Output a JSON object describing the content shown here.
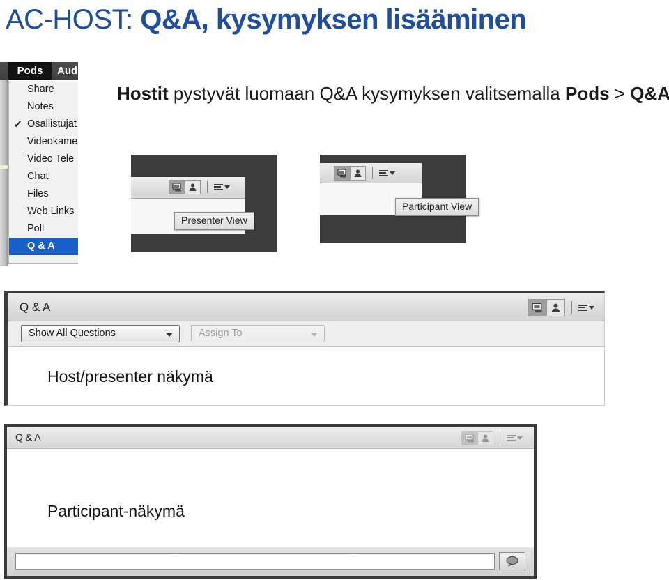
{
  "slide": {
    "title_prefix": "AC-HOST: ",
    "title_main": "Q&A, kysymyksen lisääminen",
    "intro": {
      "bold_1": "Hostit",
      "normal_1": " pystyvät luomaan Q&A kysymyksen valitsemalla ",
      "bold_2": "Pods",
      "normal_2": " > ",
      "bold_3": "Q&A"
    }
  },
  "pods_menu": {
    "menubar": {
      "pods_label": "Pods",
      "audio_label": "Aud"
    },
    "items": [
      {
        "label": "Share",
        "checked": false,
        "selected": false
      },
      {
        "label": "Notes",
        "checked": false,
        "selected": false
      },
      {
        "label": "Osallistujat",
        "checked": true,
        "selected": false
      },
      {
        "label": "Videokamera",
        "checked": false,
        "selected": false
      },
      {
        "label": "Video Tele",
        "checked": false,
        "selected": false
      },
      {
        "label": "Chat",
        "checked": false,
        "selected": false
      },
      {
        "label": "Files",
        "checked": false,
        "selected": false
      },
      {
        "label": "Web Links",
        "checked": false,
        "selected": false
      },
      {
        "label": "Poll",
        "checked": false,
        "selected": false
      },
      {
        "label": "Q & A",
        "checked": false,
        "selected": true
      }
    ]
  },
  "presenter_capture": {
    "tooltip": "Presenter View"
  },
  "participant_capture": {
    "tooltip": "Participant View"
  },
  "host_pod": {
    "title": "Q & A",
    "filter_dropdown": "Show All Questions",
    "assign_dropdown": "Assign To",
    "note": "Host/presenter näkymä"
  },
  "participant_pod": {
    "title": "Q & A",
    "note": "Participant-näkymä",
    "input_value": ""
  },
  "colors": {
    "title_blue": "#1f4e9c",
    "menu_highlight": "#1860c8",
    "screenshot_frame": "#3c3c3c"
  }
}
